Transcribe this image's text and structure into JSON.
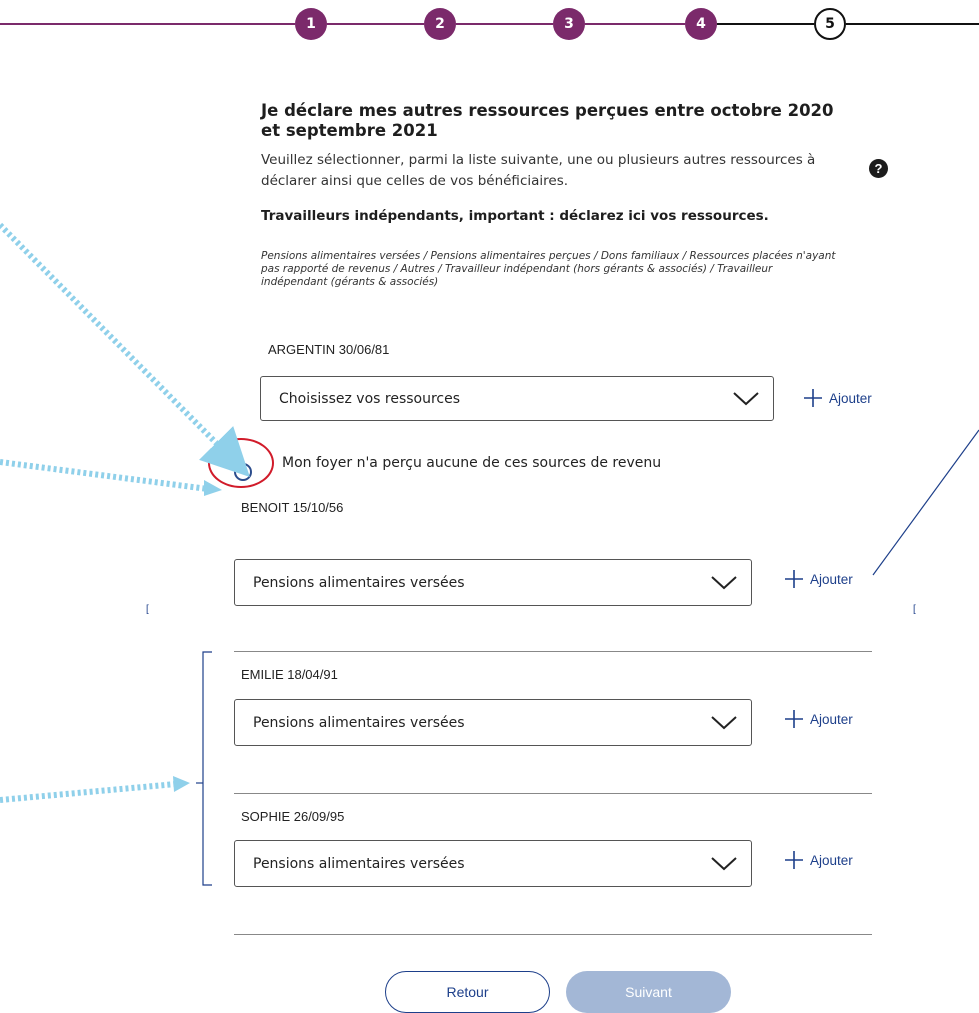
{
  "stepper": {
    "steps": [
      {
        "number": "1",
        "state": "done"
      },
      {
        "number": "2",
        "state": "done"
      },
      {
        "number": "3",
        "state": "done"
      },
      {
        "number": "4",
        "state": "done"
      },
      {
        "number": "5",
        "state": "current"
      }
    ],
    "colors": {
      "done": "#7b2a6b",
      "current_border": "#111111"
    }
  },
  "header": {
    "title": "Je déclare mes autres ressources perçues entre octobre 2020 et septembre 2021",
    "intro": "Veuillez sélectionner, parmi la liste suivante, une ou plusieurs autres ressources à déclarer ainsi que celles de vos bénéficiaires.",
    "help_icon": "question-circle-icon",
    "important": "Travailleurs indépendants, important : déclarez ici vos ressources.",
    "resource_list": "Pensions alimentaires versées / Pensions alimentaires perçues / Dons familiaux / Ressources placées n'ayant pas rapporté de revenus / Autres / Travailleur indépendant (hors gérants & associés) / Travailleur indépendant (gérants & associés)"
  },
  "persons": [
    {
      "label": "ARGENTIN 30/06/81",
      "select_value": "Choisissez vos ressources",
      "add_label": "Ajouter"
    },
    {
      "label": "BENOIT 15/10/56",
      "select_value": "Pensions alimentaires versées",
      "add_label": "Ajouter"
    },
    {
      "label": "EMILIE 18/04/91",
      "select_value": "Pensions alimentaires versées",
      "add_label": "Ajouter"
    },
    {
      "label": "SOPHIE 26/09/95",
      "select_value": "Pensions alimentaires versées",
      "add_label": "Ajouter"
    }
  ],
  "no_income_option": {
    "label": "Mon foyer n'a perçu aucune de ces sources de revenu",
    "checked": false
  },
  "actions": {
    "back_label": "Retour",
    "next_label": "Suivant",
    "next_enabled": false
  },
  "annotations": {
    "arrow_color": "#8fd0ea",
    "highlight_color": "#d11b2a"
  }
}
